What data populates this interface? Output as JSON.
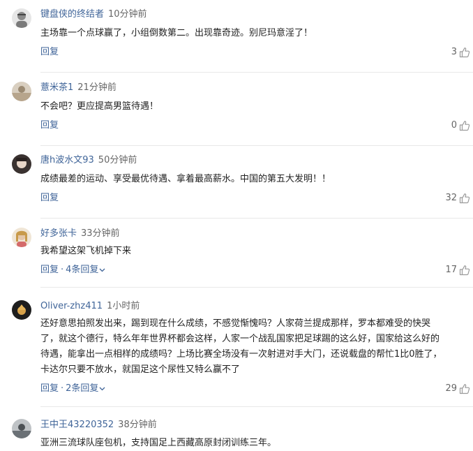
{
  "comments": [
    {
      "username": "键盘侠的终结者",
      "time": "10分钟前",
      "text": "主场靠一个点球赢了，小组倒数第二。出现靠奇迹。别尼玛意淫了！",
      "reply": "回复",
      "replies": "",
      "likes": "3"
    },
    {
      "username": "薏米茶1",
      "time": "21分钟前",
      "text": "不会吧？更应提高男篮待遇！",
      "reply": "回复",
      "replies": "",
      "likes": "0"
    },
    {
      "username": "唐h波水文93",
      "time": "50分钟前",
      "text": "成绩最差的运动、享受最优待遇、拿着最高薪水。中国的第五大发明！！",
      "reply": "回复",
      "replies": "",
      "likes": "32"
    },
    {
      "username": "好多张卡",
      "time": "33分钟前",
      "text": "我希望这架飞机掉下来",
      "reply": "回复",
      "replies": "4条回复",
      "likes": "17"
    },
    {
      "username": "Oliver-zhz411",
      "time": "1小时前",
      "text_lines": [
        "还好意思拍照发出来，踢到现在什么成绩，不感觉惭愧吗？人家荷兰提成那样，罗本都难受的快哭",
        "了，就这个德行，特么年年世界杯都会这样，人家一个战乱国家把足球踢的这么好，国家给这么好的",
        "待遇，能拿出一点相样的成绩吗？上场比赛全场没有一次射进对手大门，还说载盘的帮忙1比0胜了，",
        "卡达尔只要不放水，就国足这个尿性又特么赢不了"
      ],
      "reply": "回复",
      "replies": "2条回复",
      "likes": "29"
    },
    {
      "username": "王中王43220352",
      "time": "38分钟前",
      "text": "亚洲三流球队座包机，支持国足上西藏高原封闭训练三年。"
    }
  ],
  "icons": {
    "like": "thumbs-up-icon",
    "expand": "chevron-down-icon"
  },
  "colors": {
    "username": "#406599",
    "link": "#406599",
    "meta": "#666666",
    "divider": "#e8e8e8"
  }
}
